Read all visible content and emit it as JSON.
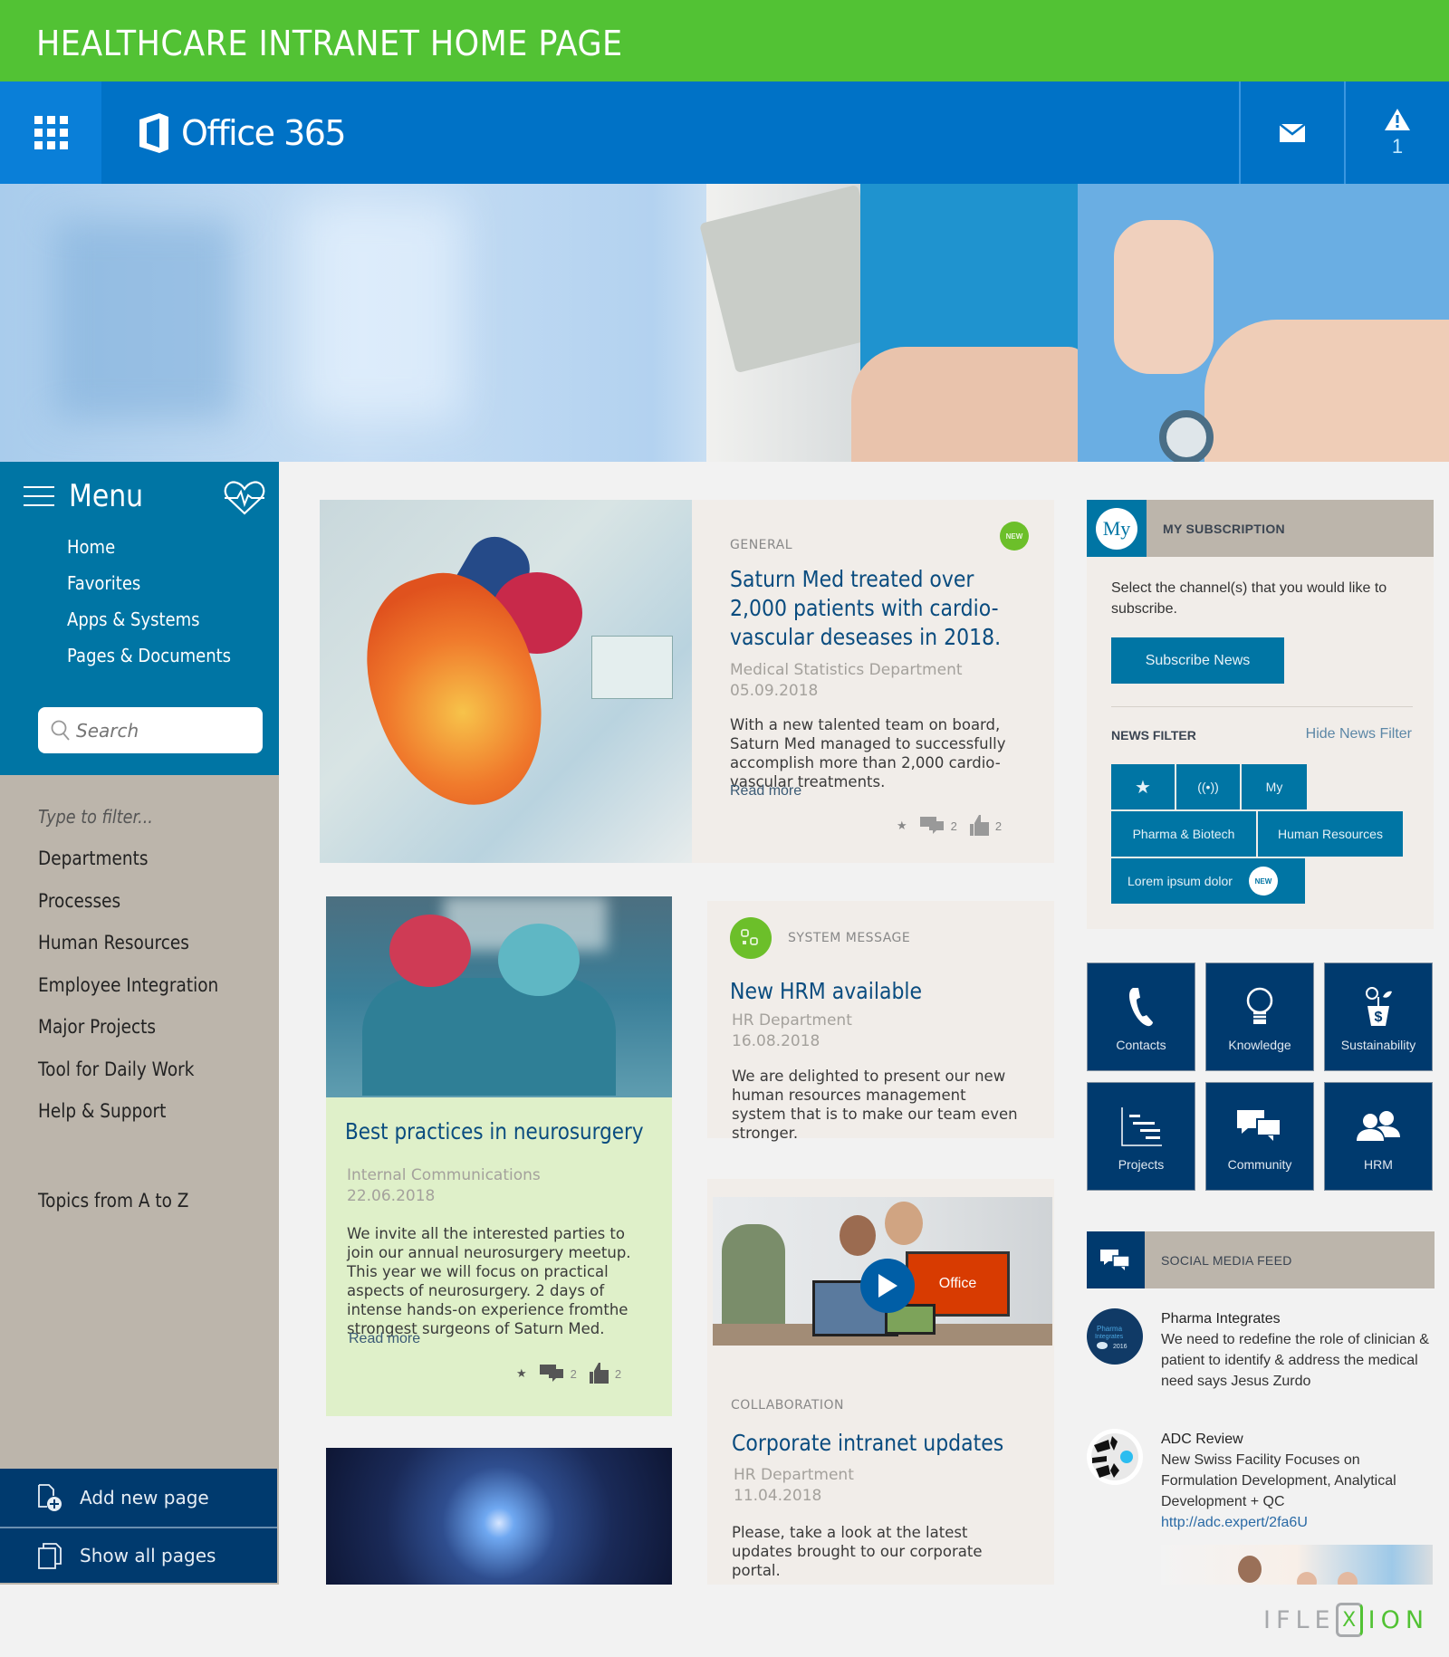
{
  "page_title": "HEALTHCARE INTRANET HOME PAGE",
  "o365": {
    "app_launcher_icon": "waffle-grid-icon",
    "logo_icon": "office-logo-icon",
    "brand": "Office 365",
    "mail_icon": "envelope-icon",
    "alert_icon": "warning-triangle-icon",
    "alert_count": "1"
  },
  "colors": {
    "banner_green": "#52c234",
    "o365_blue": "#0072c6",
    "menu_blue": "#0075a4",
    "navy": "#003a6e",
    "sidebar_taupe": "#bcb5ab",
    "card_bg": "#f1ede9",
    "highlight_card_bg": "#dff0c9",
    "title_blue": "#0a4c7f"
  },
  "sidebar": {
    "menu_label": "Menu",
    "menu_icon": "hamburger-icon",
    "heart_icon": "heartbeat-icon",
    "nav": [
      {
        "label": "Home"
      },
      {
        "label": "Favorites"
      },
      {
        "label": "Apps & Systems"
      },
      {
        "label": "Pages & Documents"
      }
    ],
    "search_placeholder": "Search",
    "filter_placeholder": "Type to filter...",
    "topics": [
      {
        "label": "Departments"
      },
      {
        "label": "Processes"
      },
      {
        "label": "Human Resources"
      },
      {
        "label": "Employee Integration"
      },
      {
        "label": "Major Projects"
      },
      {
        "label": "Tool for Daily Work"
      },
      {
        "label": "Help & Support"
      }
    ],
    "topics_az": "Topics from A to Z",
    "actions": [
      {
        "label": "Add new page",
        "icon": "add-page-icon"
      },
      {
        "label": "Show all pages",
        "icon": "pages-icon"
      }
    ]
  },
  "news": [
    {
      "category": "GENERAL",
      "badge": "NEW",
      "title": "Saturn Med treated over 2,000 patients with cardio-vascular deseases in 2018.",
      "department": "Medical Statistics Department",
      "date": "05.09.2018",
      "body": "With a new talented team on board, Saturn Med managed to successfully accomplish more than 2,000 cardio-vascular treatments.",
      "read_more": "Read more",
      "comments": "2",
      "likes": "2"
    },
    {
      "category": "",
      "title": "Best practices in neurosurgery",
      "department": "Internal Communications",
      "date": "22.06.2018",
      "body": "We invite all the interested parties to join our annual neurosurgery meetup. This year we will focus on practical aspects of neurosurgery. 2 days of intense hands-on experience fromthe strongest surgeons of Saturn Med.",
      "read_more": "Read more",
      "comments": "2",
      "likes": "2"
    },
    {
      "category": "SYSTEM MESSAGE",
      "title": "New HRM available",
      "department": "HR Department",
      "date": "16.08.2018",
      "body": "We are delighted to present our new human resources management system that is to make our team even stronger."
    },
    {
      "category": "COLLABORATION",
      "title": "Corporate intranet updates",
      "department": "HR Department",
      "date": "11.04.2018",
      "body": "Please, take a look at the latest updates brought to our corporate portal.",
      "video_label": "Office"
    }
  ],
  "subscription": {
    "icon_text": "My",
    "title": "MY SUBSCRIPTION",
    "description": "Select the channel(s) that you would like to subscribe.",
    "button": "Subscribe News",
    "filter_label": "NEWS FILTER",
    "hide_filter": "Hide News Filter",
    "tags_row1": [
      {
        "label": "★",
        "icon": "star-icon"
      },
      {
        "label": "((•))",
        "icon": "broadcast-icon"
      },
      {
        "label": "My"
      }
    ],
    "tags_row2": [
      {
        "label": "Pharma & Biotech"
      },
      {
        "label": "Human Resources"
      }
    ],
    "tags_row3": [
      {
        "label": "Lorem ipsum dolor",
        "badge": "NEW"
      }
    ]
  },
  "tiles": [
    {
      "label": "Contacts",
      "icon": "phone-icon"
    },
    {
      "label": "Knowledge",
      "icon": "lightbulb-icon"
    },
    {
      "label": "Sustainability",
      "icon": "plant-money-icon"
    },
    {
      "label": "Projects",
      "icon": "gantt-icon"
    },
    {
      "label": "Community",
      "icon": "chat-bubbles-icon"
    },
    {
      "label": "HRM",
      "icon": "people-icon"
    }
  ],
  "social": {
    "title": "SOCIAL MEDIA FEED",
    "posts": [
      {
        "author": "Pharma Integrates",
        "avatar_text": "Pharma Integrates 2016",
        "text": "We need to redefine the role of clinician & patient to identify & address the medical need says Jesus Zurdo"
      },
      {
        "author": "ADC Review",
        "text": "New Swiss Facility Focuses on Formulation Development, Analytical Development + QC",
        "link": "http://adc.expert/2fa6U"
      }
    ]
  },
  "footer": {
    "brand_left": "IFLE",
    "brand_mid": "X",
    "brand_right": "ION"
  }
}
